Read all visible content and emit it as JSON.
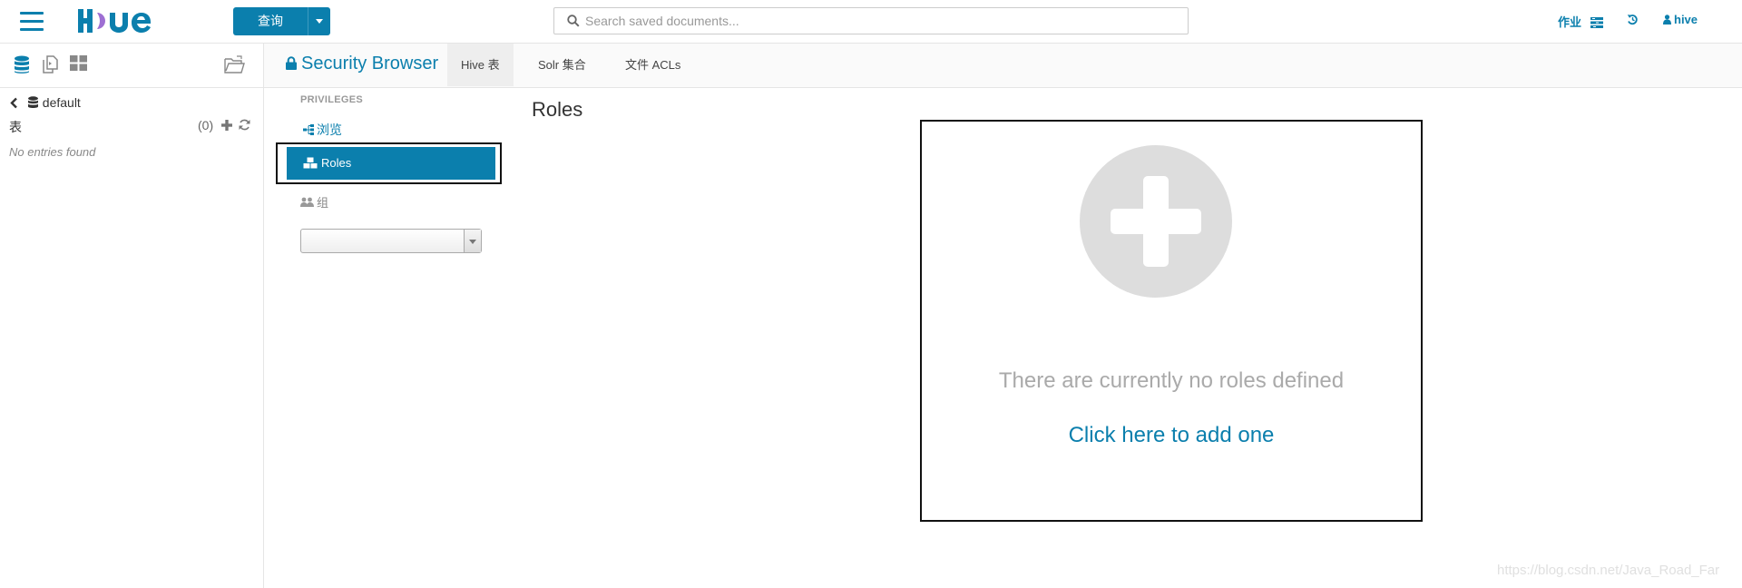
{
  "header": {
    "query_button_label": "查询",
    "search_placeholder": "Search saved documents...",
    "jobs_label": "作业",
    "user_label": "hive"
  },
  "sidebar": {
    "database_name": "default",
    "tables_label": "表",
    "tables_count": "(0)",
    "empty_text": "No entries found"
  },
  "app": {
    "title": "Security Browser",
    "tabs": [
      {
        "label": "Hive 表",
        "active": true
      },
      {
        "label": "Solr 集合",
        "active": false
      },
      {
        "label": "文件 ACLs",
        "active": false
      }
    ]
  },
  "subnav": {
    "privileges_header": "PRIVILEGES",
    "browse_label": "浏览",
    "roles_label": "Roles",
    "groups_label": "组",
    "group_select_value": ""
  },
  "main": {
    "title": "Roles",
    "empty_message": "There are currently no roles defined",
    "add_link": "Click here to add one"
  },
  "watermark": "https://blog.csdn.net/Java_Road_Far",
  "colors": {
    "accent": "#0b7fad",
    "muted_text": "#aaaaaa",
    "placeholder_circle": "#dddddd"
  }
}
